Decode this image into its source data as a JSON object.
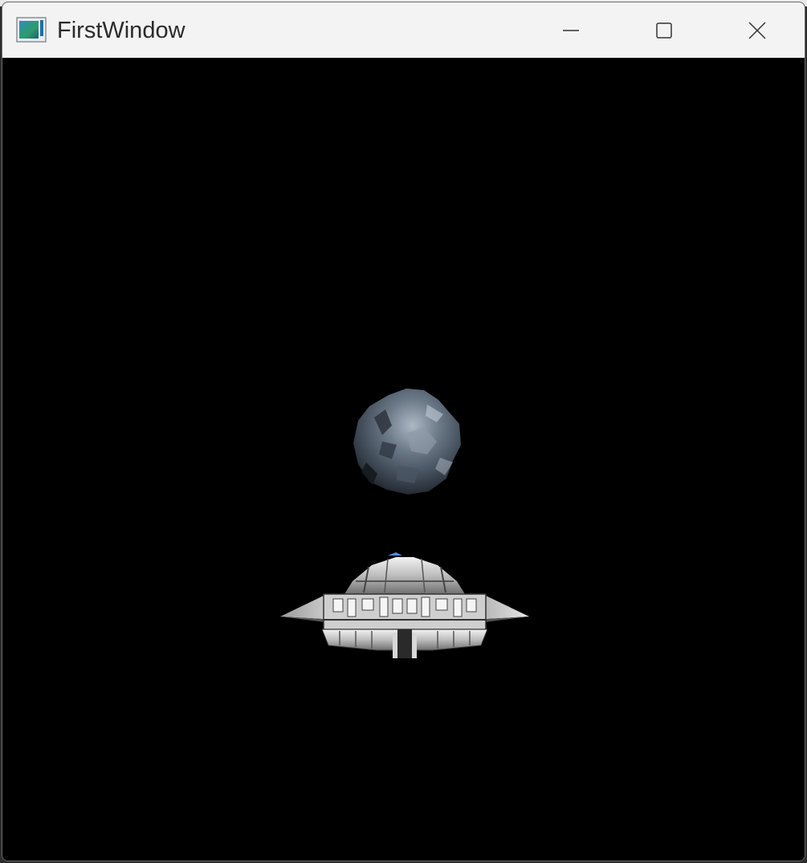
{
  "window": {
    "title": "FirstWindow",
    "app_icon": "app-window-icon",
    "controls": {
      "minimize_icon": "minimize-icon",
      "maximize_icon": "maximize-icon",
      "close_icon": "close-icon"
    }
  },
  "scene": {
    "background_color": "#000000",
    "objects": [
      {
        "name": "asteroid",
        "colors": [
          "#5e6b7a",
          "#3a4450",
          "#9aa6b3"
        ]
      },
      {
        "name": "spaceship",
        "colors": [
          "#d9d9d9",
          "#8a8a8a",
          "#4e8df0"
        ]
      }
    ]
  }
}
